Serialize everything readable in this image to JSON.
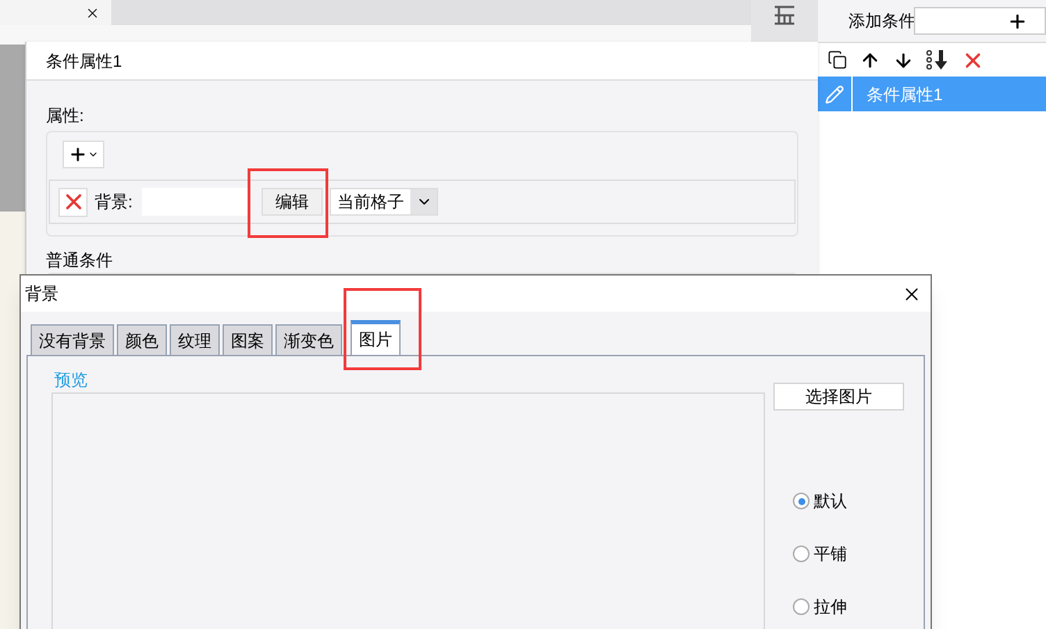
{
  "side_panel": {
    "add_label": "添加条件",
    "conditions": [
      {
        "label": "条件属性1",
        "selected": true
      }
    ]
  },
  "condition_dialog": {
    "title": "条件属性1",
    "properties_legend": "属性:",
    "background_label": "背景:",
    "edit_button": "编辑",
    "scope_select": "当前格子",
    "general_legend": "普通条件"
  },
  "background_dialog": {
    "title": "背景",
    "tabs": [
      {
        "label": "没有背景",
        "selected": false
      },
      {
        "label": "颜色",
        "selected": false
      },
      {
        "label": "纹理",
        "selected": false
      },
      {
        "label": "图案",
        "selected": false
      },
      {
        "label": "渐变色",
        "selected": false
      },
      {
        "label": "图片",
        "selected": true
      }
    ],
    "preview_legend": "预览",
    "choose_button": "选择图片",
    "layout_options": [
      {
        "label": "默认",
        "selected": true
      },
      {
        "label": "平铺",
        "selected": false
      },
      {
        "label": "拉伸",
        "selected": false
      }
    ]
  }
}
